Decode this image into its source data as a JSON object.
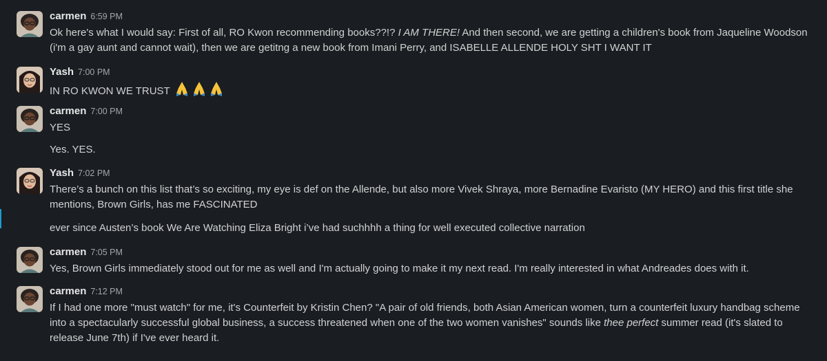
{
  "messages": [
    {
      "author": "carmen",
      "time": "6:59 PM",
      "lines": [
        {
          "pre": "Ok here's what I would say: First of all, RO Kwon recommending books??!? ",
          "em": "I AM THERE!",
          "post": "  And then second, we are getting a children's book from Jaqueline Woodson (i'm a gay aunt and cannot wait), then we are getitng a new book from Imani Perry, and ISABELLE ALLENDE HOLY SHT I WANT IT"
        }
      ]
    },
    {
      "author": "Yash",
      "time": "7:00 PM",
      "lines": [
        {
          "text": "IN RO KWON WE TRUST"
        }
      ],
      "reactions": [
        "folded-hands-emoji",
        "folded-hands-emoji",
        "folded-hands-emoji"
      ]
    },
    {
      "author": "carmen",
      "time": "7:00 PM",
      "lines": [
        {
          "text": "YES"
        },
        {
          "text": "Yes. YES."
        }
      ]
    },
    {
      "author": "Yash",
      "time": "7:02 PM",
      "lines": [
        {
          "text": "There’s a bunch on this list that’s so exciting, my eye is def on the Allende, but also more Vivek Shraya, more Bernadine Evaristo (MY HERO) and this first title she mentions, Brown Girls, has me FASCINATED"
        },
        {
          "text": "ever since Austen’s book We Are Watching Eliza Bright i’ve had suchhhh a thing for well executed collective narration"
        }
      ]
    },
    {
      "author": "carmen",
      "time": "7:05 PM",
      "lines": [
        {
          "text": "Yes, Brown Girls immediately stood out for me as well and I'm actually going to make it my next read. I'm really interested in what Andreades does with it."
        }
      ]
    },
    {
      "author": "carmen",
      "time": "7:12 PM",
      "lines": [
        {
          "pre": "If I had one more \"must watch\" for me, it's Counterfeit by Kristin Chen? \"A pair of old friends, both Asian American women, turn a counterfeit luxury handbag scheme into a spectacularly successful global business, a success threatened when one of the two women vanishes\" sounds like ",
          "em": "thee perfect",
          "post": " summer read (it's slated to release June 7th) if I've ever heard it."
        }
      ]
    }
  ],
  "colors": {
    "background": "#1a1d21",
    "text": "#d1d2d3",
    "name": "#e6e7e8",
    "timestamp": "#a5a7a9",
    "marker": "#1d9bd1"
  }
}
